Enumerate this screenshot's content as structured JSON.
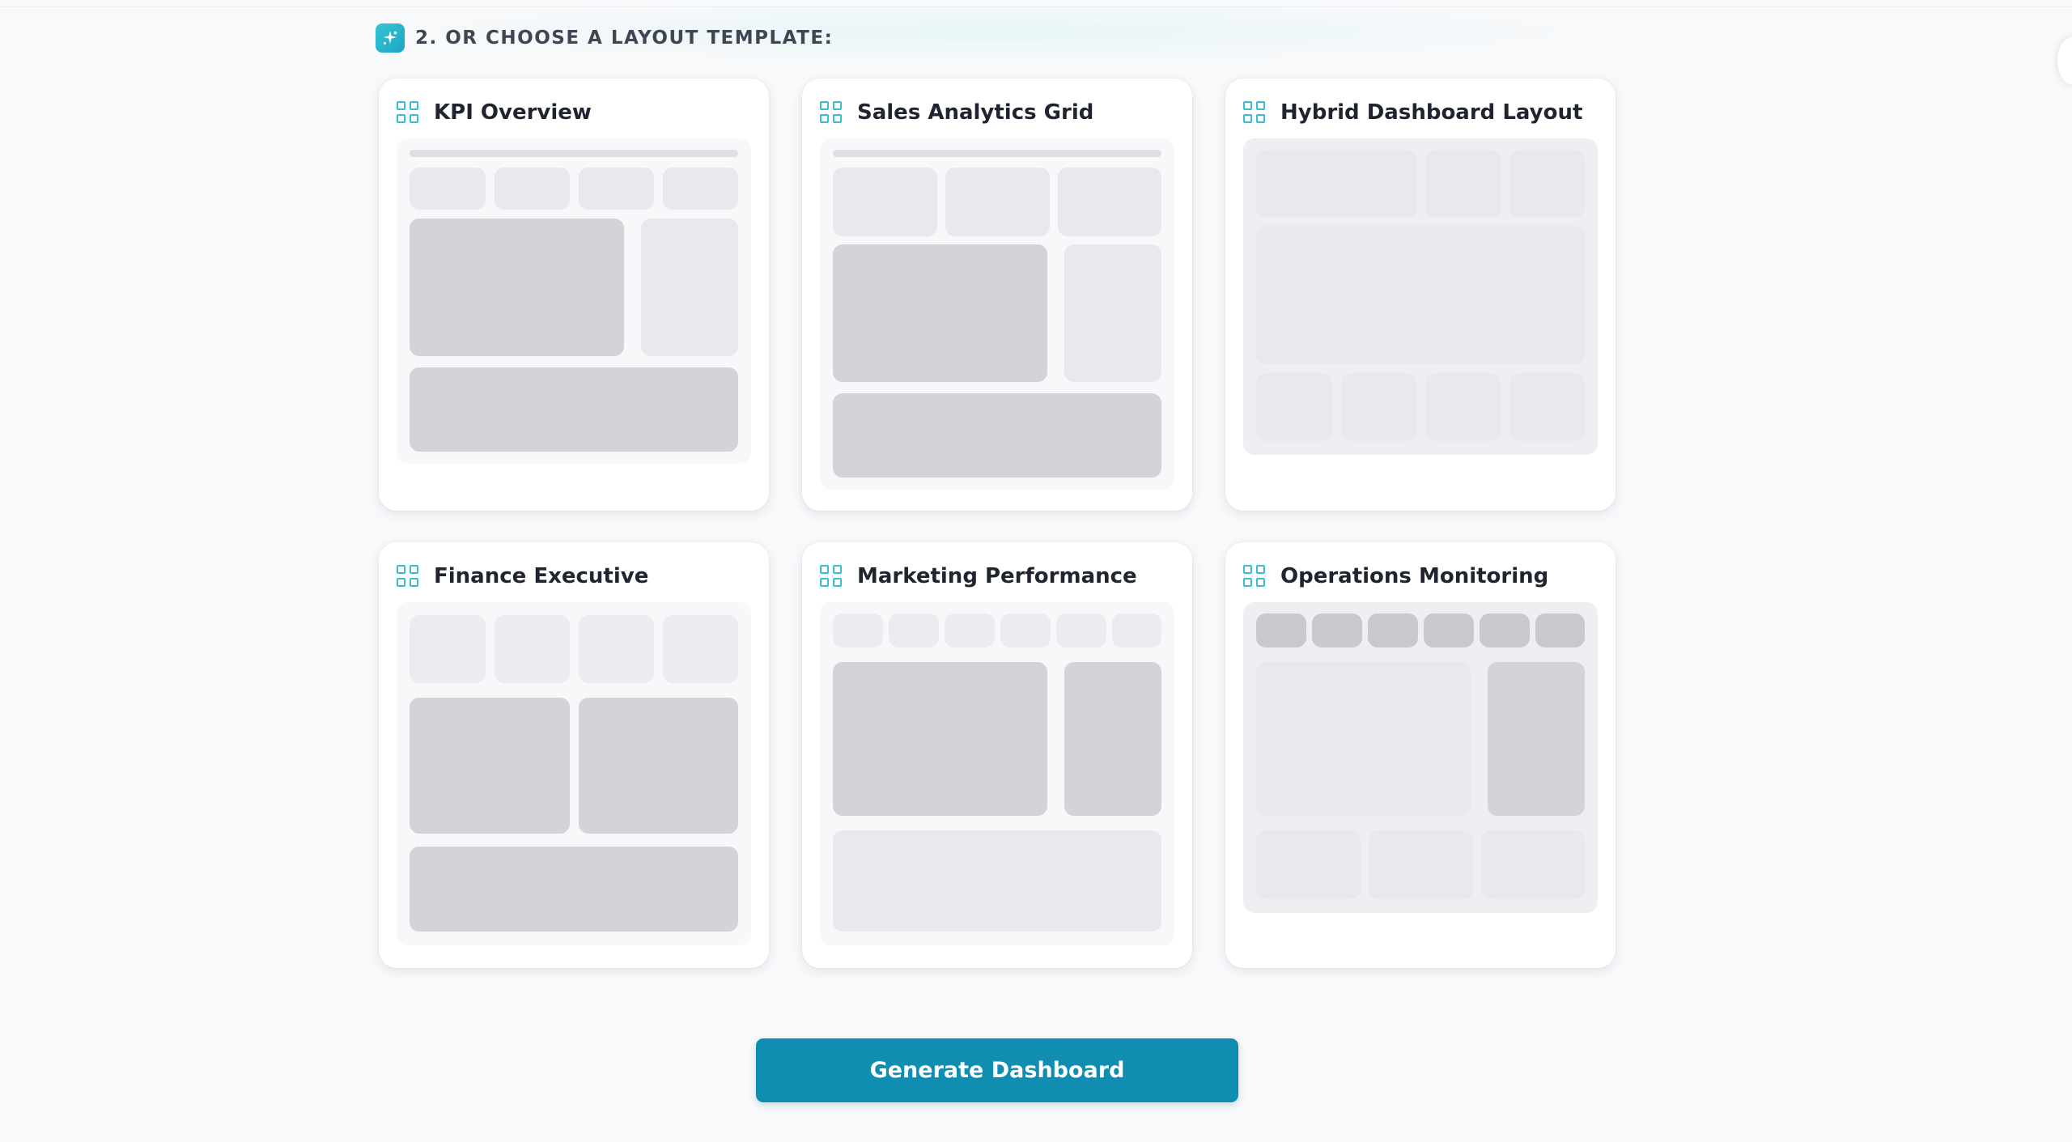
{
  "section": {
    "title": "2. OR CHOOSE A LAYOUT TEMPLATE:",
    "icon": "sparkle-icon"
  },
  "templates": [
    {
      "title": "KPI Overview",
      "icon": "grid-icon"
    },
    {
      "title": "Sales Analytics Grid",
      "icon": "grid-icon"
    },
    {
      "title": "Hybrid Dashboard Layout",
      "icon": "grid-icon"
    },
    {
      "title": "Finance Executive",
      "icon": "grid-icon"
    },
    {
      "title": "Marketing Performance",
      "icon": "grid-icon"
    },
    {
      "title": "Operations Monitoring",
      "icon": "grid-icon"
    }
  ],
  "actions": {
    "generate_label": "Generate Dashboard"
  },
  "colors": {
    "accent": "#0f8eb2",
    "icon_accent": "#3dbcd2"
  }
}
